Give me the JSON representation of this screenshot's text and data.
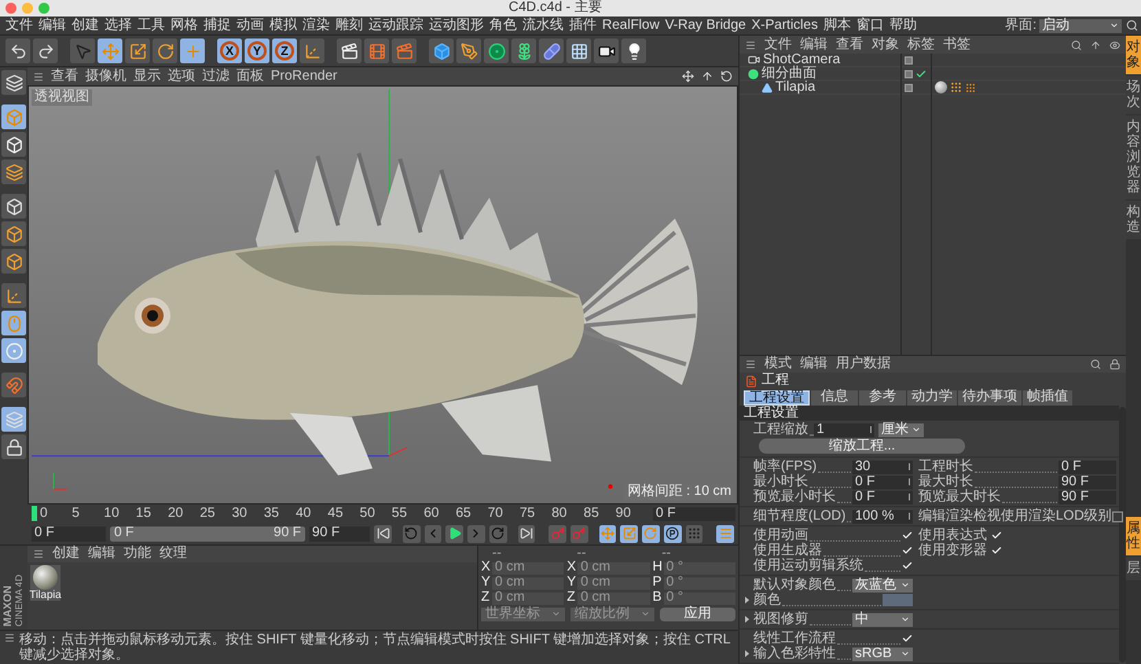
{
  "window": {
    "title": "C4D.c4d - 主要"
  },
  "menu_bar": {
    "items": [
      "文件",
      "编辑",
      "创建",
      "选择",
      "工具",
      "网格",
      "捕捉",
      "动画",
      "模拟",
      "渲染",
      "雕刻",
      "运动跟踪",
      "运动图形",
      "角色",
      "流水线",
      "插件",
      "RealFlow",
      "V-Ray Bridge",
      "X-Particles",
      "脚本",
      "窗口",
      "帮助"
    ],
    "layout_label": "界面:",
    "layout_value": "启动"
  },
  "toolbar": {
    "axis_buttons": [
      {
        "label": "X",
        "selected": true
      },
      {
        "label": "Y",
        "selected": true
      },
      {
        "label": "Z",
        "selected": true
      }
    ]
  },
  "viewport": {
    "menu": [
      "查看",
      "摄像机",
      "显示",
      "选项",
      "过滤",
      "面板",
      "ProRender"
    ],
    "view_label": "透视视图",
    "grid_spacing": "网格间距 : 10 cm"
  },
  "timeline": {
    "ticks": [
      "0",
      "5",
      "10",
      "15",
      "20",
      "25",
      "30",
      "35",
      "40",
      "45",
      "50",
      "55",
      "60",
      "65",
      "70",
      "75",
      "80",
      "85",
      "90"
    ],
    "level": 0,
    "current_frame": "0 F"
  },
  "transport": {
    "start": "0 F",
    "range_start": "0 F",
    "range_end": "90 F",
    "level": 1,
    "end": "90 F"
  },
  "material_manager": {
    "menu": [
      "创建",
      "编辑",
      "功能",
      "纹理"
    ],
    "materials": [
      {
        "name": "Tilapia"
      }
    ]
  },
  "logo": {
    "brand": "MAXON",
    "product": "CINEMA 4D"
  },
  "coordinates": {
    "disabled": true,
    "headers": [
      "--",
      "--",
      "--"
    ],
    "rows": [
      [
        {
          "axis": "X",
          "value": "0 cm"
        },
        {
          "axis": "X",
          "value": "0 cm"
        },
        {
          "axis": "H",
          "value": "0 °"
        }
      ],
      [
        {
          "axis": "Y",
          "value": "0 cm"
        },
        {
          "axis": "Y",
          "value": "0 cm"
        },
        {
          "axis": "P",
          "value": "0 °"
        }
      ],
      [
        {
          "axis": "Z",
          "value": "0 cm"
        },
        {
          "axis": "Z",
          "value": "0 cm"
        },
        {
          "axis": "B",
          "value": "0 °"
        }
      ]
    ],
    "mode_dropdown": "世界坐标",
    "scale_dropdown": "缩放比例",
    "apply_button": "应用"
  },
  "status_bar": "移动：点击并拖动鼠标移动元素。按住 SHIFT 键量化移动；节点编辑模式时按住 SHIFT 键增加选择对象；按住 CTRL 键减少选择对象。",
  "object_manager": {
    "menu": [
      "文件",
      "编辑",
      "查看",
      "对象",
      "标签",
      "书签"
    ],
    "objects": [
      {
        "name": "ShotCamera",
        "kind": "camera"
      },
      {
        "name": "细分曲面",
        "kind": "generator",
        "enabled": true,
        "children": [
          {
            "name": "Tilapia",
            "kind": "mesh",
            "tags": [
              {
                "kind": "material"
              },
              {
                "kind": "phong"
              },
              {
                "kind": "points"
              }
            ]
          }
        ]
      }
    ]
  },
  "side_tabs": {
    "upper": [
      {
        "label": "对象",
        "selected": true
      },
      {
        "label": "场次",
        "selected": false
      },
      {
        "label": "内容浏览器",
        "selected": false
      },
      {
        "label": "构造",
        "selected": false
      }
    ],
    "lower": [
      {
        "label": "属性",
        "selected": true
      },
      {
        "label": "层",
        "selected": false
      }
    ]
  },
  "attributes": {
    "menu": [
      "模式",
      "编辑",
      "用户数据"
    ],
    "title": "工程",
    "tabs": [
      {
        "label": "工程设置",
        "selected": true
      },
      {
        "label": "信息",
        "selected": false
      },
      {
        "label": "参考",
        "selected": false
      },
      {
        "label": "动力学",
        "selected": false
      },
      {
        "label": "待办事项",
        "selected": false
      },
      {
        "label": "帧插值",
        "selected": false
      }
    ],
    "section": "工程设置",
    "groups": [
      [
        [
          {
            "kind": "number",
            "label": "工程缩放",
            "value": "1",
            "unit": "厘米"
          }
        ],
        [
          {
            "kind": "button",
            "label": "缩放工程..."
          }
        ]
      ],
      [
        [
          {
            "kind": "number",
            "label": "帧率(FPS)",
            "value": "30"
          },
          {
            "kind": "value",
            "label": "工程时长",
            "value": "0 F"
          }
        ],
        [
          {
            "kind": "number",
            "label": "最小时长",
            "value": "0 F"
          },
          {
            "kind": "value",
            "label": "最大时长",
            "value": "90 F"
          }
        ],
        [
          {
            "kind": "number",
            "label": "预览最小时长",
            "value": "0 F"
          },
          {
            "kind": "value",
            "label": "预览最大时长",
            "value": "90 F"
          }
        ]
      ],
      [
        [
          {
            "kind": "number",
            "label": "细节程度(LOD)",
            "value": "100 %"
          },
          {
            "kind": "checkbox",
            "label": "编辑渲染检视使用渲染LOD级别",
            "checked": false
          }
        ]
      ],
      [
        [
          {
            "kind": "checkbox",
            "label": "使用动画",
            "checked": true
          },
          {
            "kind": "checkbox",
            "label": "使用表达式",
            "checked": true
          }
        ],
        [
          {
            "kind": "checkbox",
            "label": "使用生成器",
            "checked": true
          },
          {
            "kind": "checkbox",
            "label": "使用变形器",
            "checked": true
          }
        ],
        [
          {
            "kind": "checkbox",
            "label": "使用运动剪辑系统",
            "checked": true
          }
        ]
      ],
      [
        [
          {
            "kind": "dropdown",
            "label": "默认对象颜色",
            "value": "灰蓝色"
          }
        ],
        [
          {
            "kind": "color",
            "label": "颜色",
            "color": "#5d6b7c",
            "expanded": false
          }
        ]
      ],
      [
        [
          {
            "kind": "dropdown",
            "label": "视图修剪",
            "value": "中",
            "expanded": false
          }
        ]
      ],
      [
        [
          {
            "kind": "checkbox",
            "label": "线性工作流程",
            "checked": true
          }
        ],
        [
          {
            "kind": "dropdown",
            "label": "输入色彩特性",
            "value": "sRGB",
            "expanded": false
          }
        ]
      ]
    ]
  }
}
